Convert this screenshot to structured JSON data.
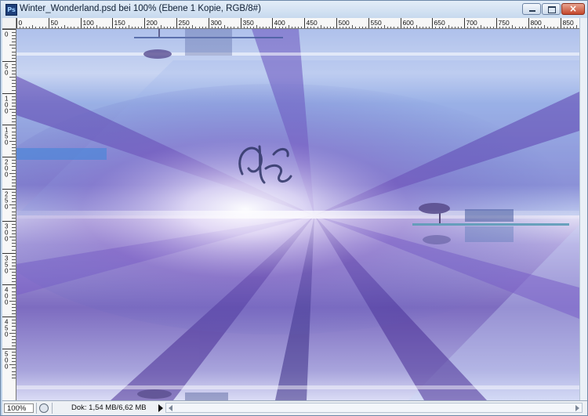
{
  "window": {
    "title": "Winter_Wonderland.psd bei 100% (Ebene 1 Kopie, RGB/8#)",
    "app_icon_label": "Ps",
    "buttons": {
      "minimize": "minimize-icon",
      "maximize": "maximize-icon",
      "close": "×"
    }
  },
  "rulers": {
    "horizontal": [
      "0",
      "50",
      "100",
      "150",
      "200",
      "250",
      "300",
      "350",
      "400",
      "450",
      "500",
      "550",
      "600",
      "650",
      "700",
      "750",
      "800",
      "850"
    ],
    "vertical": [
      "0",
      "5\n0",
      "1\n0\n0",
      "1\n5\n0",
      "2\n0\n0",
      "2\n5\n0",
      "3\n0\n0",
      "3\n5\n0",
      "4\n0\n0",
      "4\n5\n0",
      "5\n0\n0"
    ]
  },
  "status": {
    "zoom": "100%",
    "doc_info": "Dok: 1,54 MB/6,62 MB"
  },
  "colors": {
    "sky": "#9fb5e4",
    "violet": "#8a74c9",
    "deep_blue": "#3e4f9e",
    "highlight": "#f3f0fb"
  }
}
